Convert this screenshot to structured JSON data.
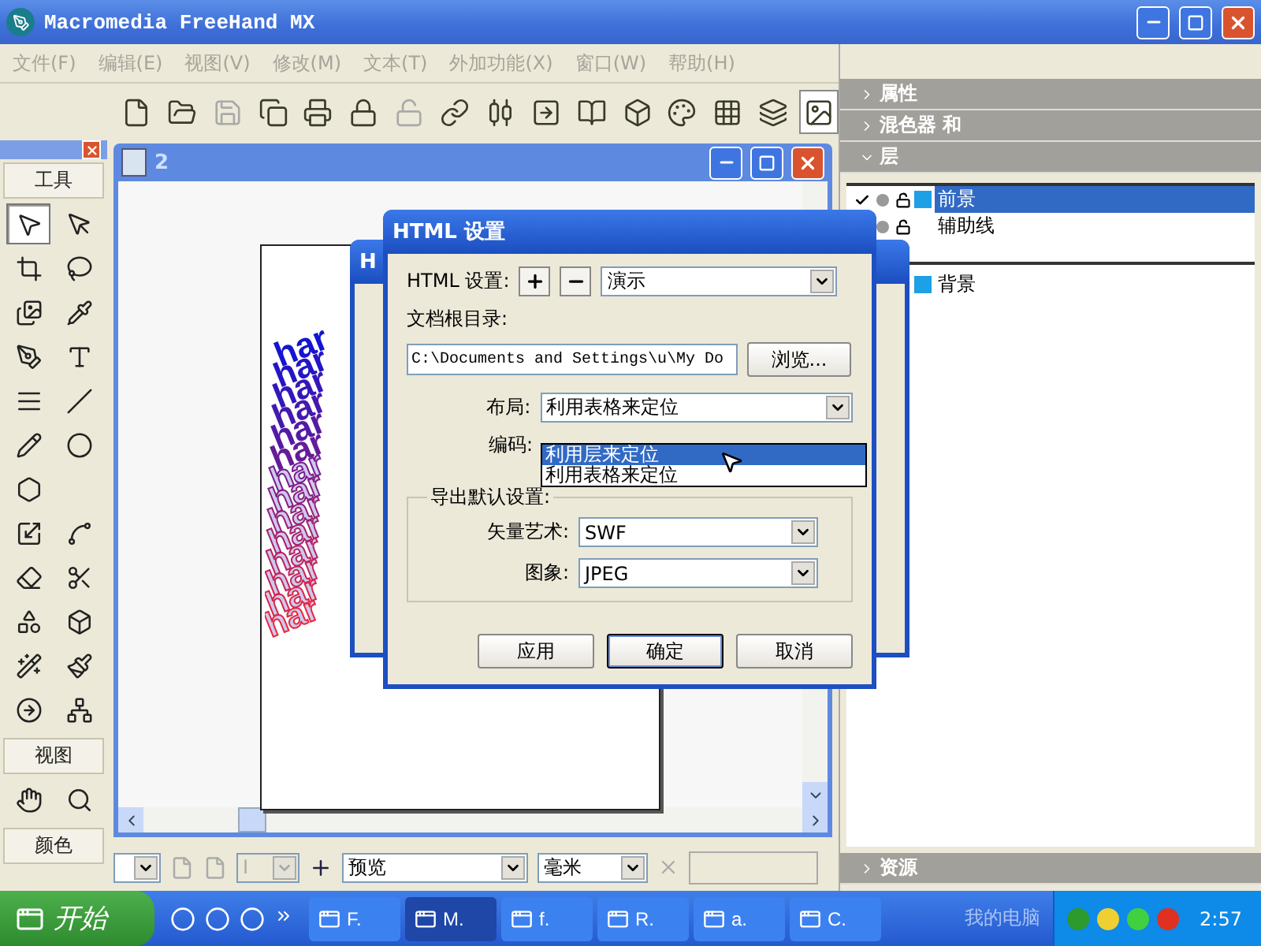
{
  "window": {
    "title": "Macromedia FreeHand MX"
  },
  "menu": [
    "文件(F)",
    "编辑(E)",
    "视图(V)",
    "修改(M)",
    "文本(T)",
    "外加功能(X)",
    "窗口(W)",
    "帮助(H)"
  ],
  "toolbar": [
    {
      "disabled": false,
      "selected": false
    },
    {
      "disabled": false,
      "selected": false
    },
    {
      "disabled": true,
      "selected": false
    },
    {
      "disabled": false,
      "selected": false
    },
    {
      "disabled": false,
      "selected": false
    },
    {
      "disabled": false,
      "selected": false
    },
    {
      "disabled": true,
      "selected": false
    },
    {
      "disabled": false,
      "selected": false
    },
    {
      "disabled": false,
      "selected": false
    },
    {
      "disabled": false,
      "selected": false
    },
    {
      "disabled": false,
      "selected": false
    },
    {
      "disabled": false,
      "selected": false
    },
    {
      "disabled": false,
      "selected": false
    },
    {
      "disabled": false,
      "selected": false
    },
    {
      "disabled": false,
      "selected": false
    },
    {
      "disabled": false,
      "selected": true
    }
  ],
  "toolbox": {
    "title": "工具",
    "tools": [
      {
        "selected": true
      },
      {
        "selected": false
      },
      {
        "selected": false
      },
      {
        "selected": false
      },
      {
        "selected": false
      },
      {
        "selected": false
      },
      {
        "selected": false
      },
      {
        "selected": false
      },
      {
        "selected": false
      },
      {
        "selected": false
      },
      {
        "selected": false
      },
      {
        "selected": false
      },
      {
        "selected": false
      },
      {
        "selected": false
      },
      {
        "selected": false
      },
      {
        "selected": false
      },
      {
        "selected": false
      },
      {
        "selected": false
      },
      {
        "selected": false
      },
      {
        "selected": false
      },
      {
        "selected": false
      },
      {
        "selected": false
      },
      {
        "selected": false
      }
    ],
    "view_title": "视图",
    "view_tools": [
      {
        "selected": false
      },
      {
        "selected": false
      }
    ],
    "color_title": "颜色"
  },
  "document": {
    "title": "2",
    "artwork": [
      "har",
      "har",
      "har",
      "har",
      "har",
      "har",
      "har",
      "har",
      "har",
      "har",
      "har",
      "har",
      "har",
      "har"
    ]
  },
  "back_dialog": {
    "title": "H"
  },
  "dialog": {
    "title": "HTML 设置",
    "preset_label": "HTML 设置:",
    "preset_value": "演示",
    "root_label": "文档根目录:",
    "root_value": "C:\\Documents and Settings\\u\\My Do",
    "browse": "浏览...",
    "layout_label": "布局:",
    "layout_value": "利用表格来定位",
    "layout_options": [
      {
        "label": "利用层来定位",
        "selected": true
      },
      {
        "label": "利用表格来定位",
        "selected": false
      }
    ],
    "encoding_label": "编码:",
    "group_title": "导出默认设置:",
    "vector_label": "矢量艺术:",
    "vector_value": "SWF",
    "image_label": "图象:",
    "image_value": "JPEG",
    "buttons": [
      {
        "label": "应用",
        "default": false
      },
      {
        "label": "确定",
        "default": true
      },
      {
        "label": "取消",
        "default": false
      }
    ]
  },
  "panels": [
    {
      "title": "属性",
      "expanded": false
    },
    {
      "title": "混色器 和",
      "expanded": false
    },
    {
      "title": "层",
      "expanded": true
    }
  ],
  "layers": [
    {
      "name": "前景",
      "kind": "editable",
      "selected": true,
      "checked": true,
      "color": "#1ea0e6"
    },
    {
      "name": "辅助线",
      "kind": "editable",
      "selected": false
    },
    {
      "name": "背景",
      "kind": "background",
      "selected": false,
      "color": "#1ea0e6"
    }
  ],
  "resources_panel": {
    "title": "资源",
    "expanded": false
  },
  "status_bar": {
    "page_field": "I",
    "view_mode": "预览",
    "units": "毫米"
  },
  "taskbar": {
    "start": "开始",
    "tasks": [
      {
        "label": "F.",
        "selected": false
      },
      {
        "label": "M.",
        "selected": true
      },
      {
        "label": "f.",
        "selected": false
      },
      {
        "label": "R.",
        "selected": false
      },
      {
        "label": "a.",
        "selected": false
      },
      {
        "label": "C.",
        "selected": false
      }
    ],
    "toolbar_label": "我的电脑",
    "time": "2:57"
  }
}
